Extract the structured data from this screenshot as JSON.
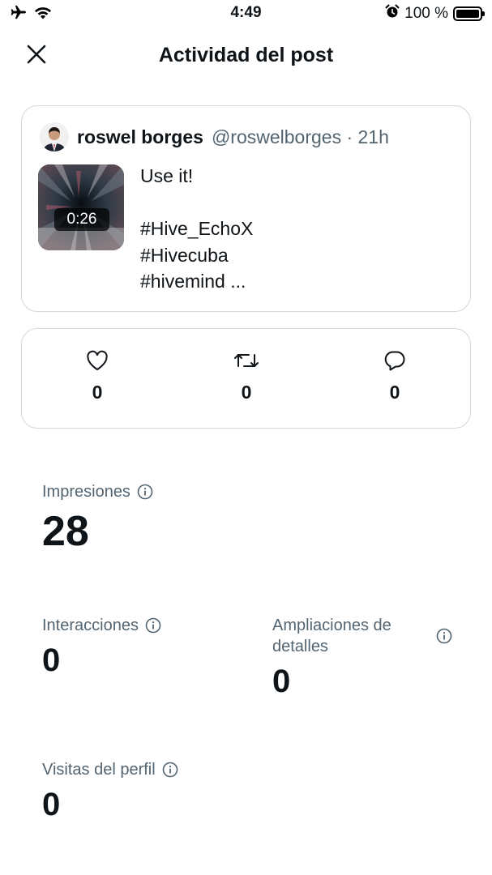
{
  "status_bar": {
    "time": "4:49",
    "battery": "100 %"
  },
  "header": {
    "title": "Actividad del post"
  },
  "post": {
    "author_name": "roswel borges",
    "author_meta": "@roswelborges · 21h",
    "video_duration": "0:26",
    "lines": [
      "Use it!",
      "",
      "#Hive_EchoX",
      "#Hivecuba",
      "#hivemind ..."
    ]
  },
  "engagement": {
    "likes": "0",
    "reposts": "0",
    "replies": "0"
  },
  "stats": {
    "impressions_label": "Impresiones",
    "impressions_value": "28",
    "interactions_label": "Interacciones",
    "interactions_value": "0",
    "expansions_label": "Ampliaciones de detalles",
    "expansions_value": "0",
    "profile_visits_label": "Visitas del perfil",
    "profile_visits_value": "0"
  },
  "colors": {
    "text_primary": "#0f1419",
    "text_secondary": "#536471",
    "border": "#cfd9de"
  }
}
